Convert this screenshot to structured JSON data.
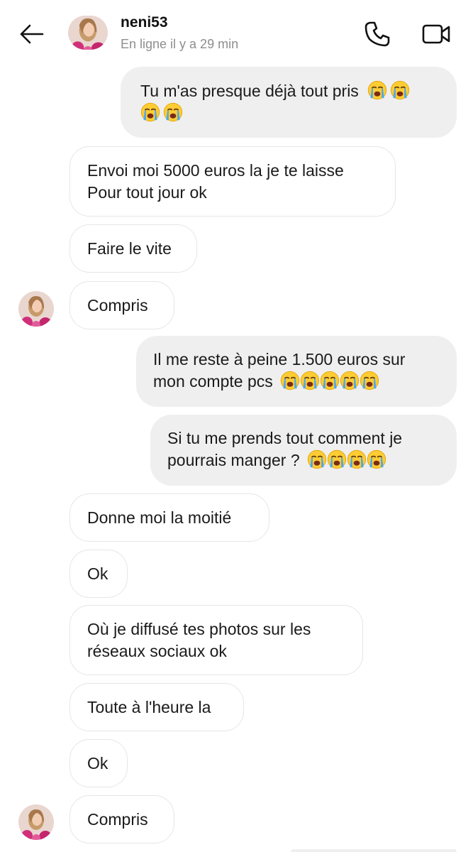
{
  "header": {
    "back_icon": "arrow-left-icon",
    "contact_name": "neni53",
    "status": "En ligne il y a 29 min",
    "call_icon": "phone-icon",
    "video_icon": "video-camera-icon"
  },
  "emoji": "loudly-crying-face",
  "messages": [
    {
      "from": "me",
      "lines": [
        "Tu m'as presque déjà tout pris",
        ""
      ]
    },
    {
      "from": "them",
      "lines": [
        "Envoi moi 5000 euros la je te laisse",
        "Pour tout jour ok"
      ]
    },
    {
      "from": "them",
      "lines": [
        "Faire le vite"
      ]
    },
    {
      "from": "them",
      "lines": [
        "Compris"
      ]
    },
    {
      "from": "me",
      "lines": [
        "Il me reste à peine 1.500 euros sur",
        "mon compte pcs"
      ]
    },
    {
      "from": "me",
      "lines": [
        "Si tu me prends tout comment je",
        "pourrais manger ?"
      ]
    },
    {
      "from": "them",
      "lines": [
        "Donne moi la moitié"
      ]
    },
    {
      "from": "them",
      "lines": [
        "Ok"
      ]
    },
    {
      "from": "them",
      "lines": [
        "Où je diffusé tes photos sur les",
        "réseaux sociaux ok"
      ]
    },
    {
      "from": "them",
      "lines": [
        "Toute à l'heure la"
      ]
    },
    {
      "from": "them",
      "lines": [
        "Ok"
      ]
    },
    {
      "from": "them",
      "lines": [
        "Compris"
      ]
    }
  ],
  "colors": {
    "outgoing_bubble": "#efefef",
    "incoming_border": "#e6e6e6",
    "status_gray": "#8e8e8e"
  }
}
